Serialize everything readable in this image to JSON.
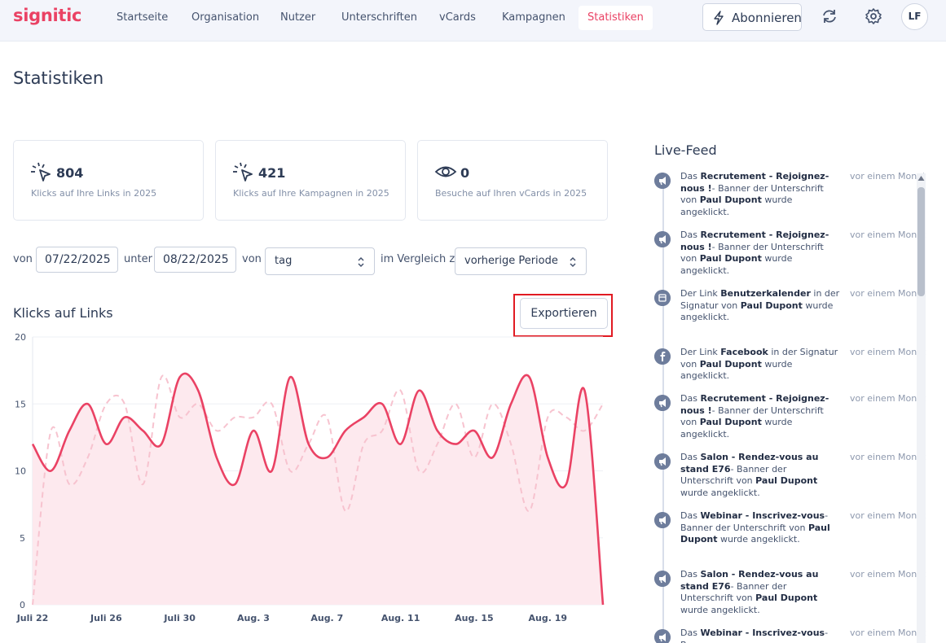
{
  "brand": "signitic",
  "nav": {
    "items": [
      {
        "label": "Startseite"
      },
      {
        "label": "Organisation"
      },
      {
        "label": "Nutzer"
      },
      {
        "label": "Unterschriften"
      },
      {
        "label": "vCards"
      },
      {
        "label": "Kampagnen"
      },
      {
        "label": "Statistiken",
        "active": true
      }
    ],
    "subscribe_label": "Abonnieren",
    "avatar_initials": "LF"
  },
  "page_title": "Statistiken",
  "stats": [
    {
      "icon": "click-icon",
      "value": "804",
      "caption": "Klicks auf Ihre Links in 2025"
    },
    {
      "icon": "click-icon",
      "value": "421",
      "caption": "Klicks auf Ihre Kampagnen in 2025"
    },
    {
      "icon": "eye-icon",
      "value": "0",
      "caption": "Besuche auf Ihren vCards in 2025"
    }
  ],
  "filters": {
    "from_label": "von",
    "from_value": "07/22/2025",
    "to_label": "unter",
    "to_value": "08/22/2025",
    "group_label": "von",
    "group_value": "tag",
    "compare_label": "im Vergleich zu",
    "compare_value": "vorherige Periode"
  },
  "chart_section": {
    "title": "Klicks auf Links",
    "export_label": "Exportieren"
  },
  "chart_data": {
    "type": "area",
    "title": "Klicks auf Links",
    "ylim": [
      0,
      20
    ],
    "yticks": [
      0,
      5,
      10,
      15,
      20
    ],
    "xtick_labels": [
      "Juli 22",
      "Juli 26",
      "Juli 30",
      "Aug. 3",
      "Aug. 7",
      "Aug. 11",
      "Aug. 15",
      "Aug. 19"
    ],
    "x": [
      "Juli 22",
      "Juli 23",
      "Juli 24",
      "Juli 25",
      "Juli 26",
      "Juli 27",
      "Juli 28",
      "Juli 29",
      "Juli 30",
      "Juli 31",
      "Aug. 1",
      "Aug. 2",
      "Aug. 3",
      "Aug. 4",
      "Aug. 5",
      "Aug. 6",
      "Aug. 7",
      "Aug. 8",
      "Aug. 9",
      "Aug. 10",
      "Aug. 11",
      "Aug. 12",
      "Aug. 13",
      "Aug. 14",
      "Aug. 15",
      "Aug. 16",
      "Aug. 17",
      "Aug. 18",
      "Aug. 19",
      "Aug. 20",
      "Aug. 21",
      "Aug. 22"
    ],
    "grid": true,
    "series": [
      {
        "values": [
          12,
          10,
          13,
          15,
          12,
          14,
          13,
          12,
          17,
          16,
          11,
          9,
          13,
          10,
          17,
          12,
          11,
          13,
          14,
          15,
          12,
          16,
          13,
          12,
          13,
          11,
          15,
          17,
          11,
          9,
          16,
          0
        ],
        "style": "solid",
        "color": "#ea4264"
      },
      {
        "values": [
          0,
          13,
          9,
          11,
          15,
          15,
          9,
          17,
          14,
          15,
          13,
          14,
          14,
          15,
          10,
          12,
          14,
          7,
          12,
          13,
          16,
          10,
          12,
          15,
          11,
          15,
          12,
          7,
          14,
          14,
          13,
          15
        ],
        "style": "dashed",
        "color": "#f7c3cf"
      }
    ]
  },
  "live_feed": {
    "title": "Live-Feed",
    "items": [
      {
        "icon": "megaphone-icon",
        "pre": "Das ",
        "bold1": "Recrutement - Rejoignez-nous !",
        "mid": "- Banner der Unterschrift von ",
        "bold2": "Paul Dupont",
        "post": " wurde angeklickt.",
        "time": "vor einem Monat"
      },
      {
        "icon": "megaphone-icon",
        "pre": "Das ",
        "bold1": "Recrutement - Rejoignez-nous !",
        "mid": "- Banner der Unterschrift von ",
        "bold2": "Paul Dupont",
        "post": " wurde angeklickt.",
        "time": "vor einem Monat"
      },
      {
        "icon": "calendar-icon",
        "pre": "Der Link ",
        "bold1": "Benutzerkalender",
        "mid": " in der Signatur von ",
        "bold2": "Paul Dupont",
        "post": " wurde angeklickt.",
        "time": "vor einem Monat"
      },
      {
        "icon": "facebook-icon",
        "pre": "Der Link ",
        "bold1": "Facebook",
        "mid": " in der Signatur von ",
        "bold2": "Paul Dupont",
        "post": " wurde angeklickt.",
        "time": "vor einem Monat"
      },
      {
        "icon": "megaphone-icon",
        "pre": "Das ",
        "bold1": "Recrutement - Rejoignez-nous !",
        "mid": "- Banner der Unterschrift von ",
        "bold2": "Paul Dupont",
        "post": " wurde angeklickt.",
        "time": "vor einem Monat"
      },
      {
        "icon": "megaphone-icon",
        "pre": "Das ",
        "bold1": "Salon - Rendez-vous au stand E76",
        "mid": "- Banner der Unterschrift von ",
        "bold2": "Paul Dupont",
        "post": " wurde angeklickt.",
        "time": "vor einem Monat"
      },
      {
        "icon": "megaphone-icon",
        "pre": "Das ",
        "bold1": "Webinar - Inscrivez-vous",
        "mid": "-Banner der Unterschrift von ",
        "bold2": "Paul Dupont",
        "post": " wurde angeklickt.",
        "time": "vor einem Monat"
      },
      {
        "icon": "megaphone-icon",
        "pre": "Das ",
        "bold1": "Salon - Rendez-vous au stand E76",
        "mid": "- Banner der Unterschrift von ",
        "bold2": "Paul Dupont",
        "post": " wurde angeklickt.",
        "time": "vor einem Monat"
      },
      {
        "icon": "megaphone-icon",
        "pre": "Das ",
        "bold1": "Webinar - Inscrivez-vous",
        "mid": "-Banner",
        "bold2": "",
        "post": "",
        "time": "vor einem Monat"
      }
    ]
  },
  "colors": {
    "brand": "#ea4264",
    "text": "#2d3b55",
    "muted": "#8390a8",
    "highlight": "#e11a22"
  }
}
